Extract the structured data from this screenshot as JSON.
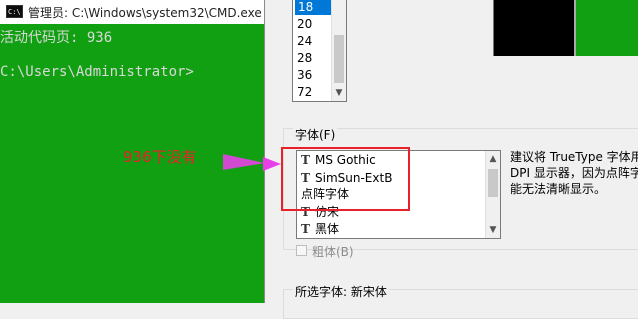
{
  "cmd": {
    "title": "管理员: C:\\Windows\\system32\\CMD.exe",
    "icon_text": "C:\\",
    "lines": [
      "活动代码页: 936",
      "C:\\Users\\Administrator>"
    ],
    "background": "#11a011"
  },
  "size_list": {
    "items": [
      "18",
      "20",
      "24",
      "28",
      "36",
      "72"
    ],
    "selected": "18"
  },
  "font_group": {
    "label": "字体(F)",
    "items": [
      {
        "name": "MS Gothic",
        "truetype": true
      },
      {
        "name": "SimSun-ExtB",
        "truetype": true
      },
      {
        "name": "点阵字体",
        "truetype": false
      },
      {
        "name": "仿宋",
        "truetype": true
      },
      {
        "name": "黑体",
        "truetype": true
      }
    ],
    "tt_glyph": "T"
  },
  "description": "建议将 TrueType 字体用\nDPI 显示器，因为点阵字\n能无法清晰显示。",
  "bold_label": "粗体(B)",
  "selected_font_label": "所选字体: 新宋体",
  "annotation": {
    "text": "936下没有",
    "color": "#e8212b"
  },
  "scroll_arrows": {
    "up": "▲",
    "down": "▼"
  }
}
